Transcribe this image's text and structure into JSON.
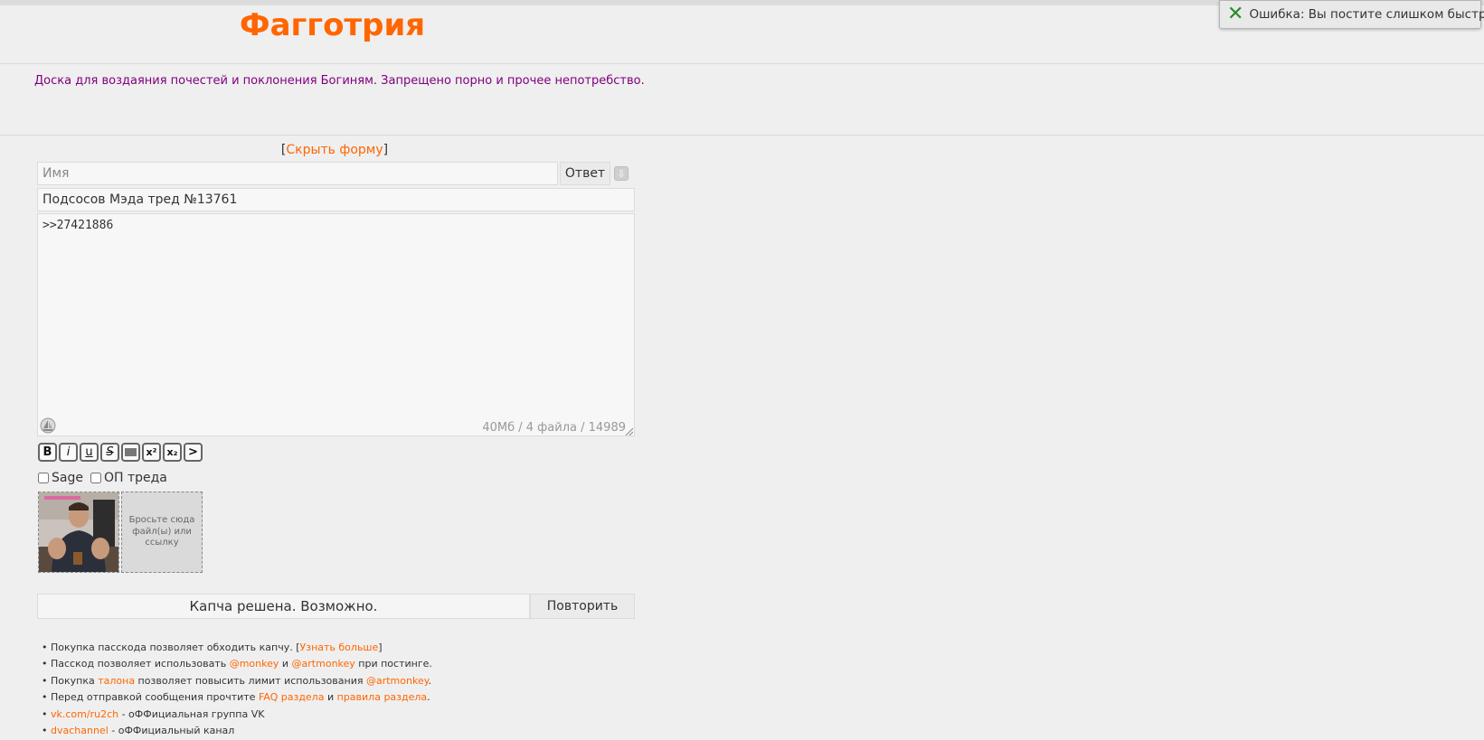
{
  "board": {
    "title": "Фагготрия",
    "description": "Доска для воздаяния почестей и поклонения Богиням. Запрещено порно и прочее непотребство."
  },
  "toast": {
    "icon": "close-x-icon",
    "text": "Ошибка: Вы постите слишком быстро."
  },
  "form": {
    "hide_form": {
      "bracket_open": "[",
      "label": "Скрыть форму",
      "bracket_close": "]"
    },
    "name_placeholder": "Имя",
    "name_value": "",
    "reply_label": "Ответ",
    "subject_value": "Подсосов Мэда тред №13761",
    "comment_value": ">>27421886",
    "counter": "40Мб / 4 файла / 14989",
    "format_buttons": [
      {
        "label": "B",
        "name": "bold-button"
      },
      {
        "label": "i",
        "name": "italic-button"
      },
      {
        "label": "u",
        "name": "underline-button"
      },
      {
        "label": "S",
        "name": "strike-button"
      },
      {
        "label": "",
        "name": "spoiler-button"
      },
      {
        "label": "x²",
        "name": "superscript-button"
      },
      {
        "label": "x₂",
        "name": "subscript-button"
      },
      {
        "label": ">",
        "name": "quote-button"
      }
    ],
    "sage_label": "Sage",
    "op_label": "ОП треда",
    "dropzone_text": "Бросьте сюда файл(ы) или ссылку",
    "captcha_text": "Капча решена. Возможно.",
    "retry_label": "Повторить"
  },
  "rules": {
    "r1": {
      "pre": "• Покупка пасскода позволяет обходить капчу. [",
      "link": "Узнать больше",
      "post": "]"
    },
    "r2": {
      "pre": "• Пасскод позволяет использовать ",
      "link1": "@monkey",
      "mid": " и ",
      "link2": "@artmonkey",
      "post": " при постинге."
    },
    "r3": {
      "pre": "• Покупка ",
      "link1": "талона",
      "mid": " позволяет повысить лимит использования ",
      "link2": "@artmonkey",
      "post": "."
    },
    "r4": {
      "pre": "• Перед отправкой сообщения прочтите ",
      "link1": "FAQ раздела",
      "mid": " и ",
      "link2": "правила раздела",
      "post": "."
    },
    "r5": {
      "pre": "• ",
      "link": "vk.com/ru2ch",
      "post": " - оФФициальная группа VK"
    },
    "r6": {
      "pre": "• ",
      "link": "dvachannel",
      "post": " - оФФициальный канал"
    }
  },
  "colors": {
    "accent": "#ff6600",
    "description": "#800080",
    "toast_icon": "#2a8a2a"
  }
}
